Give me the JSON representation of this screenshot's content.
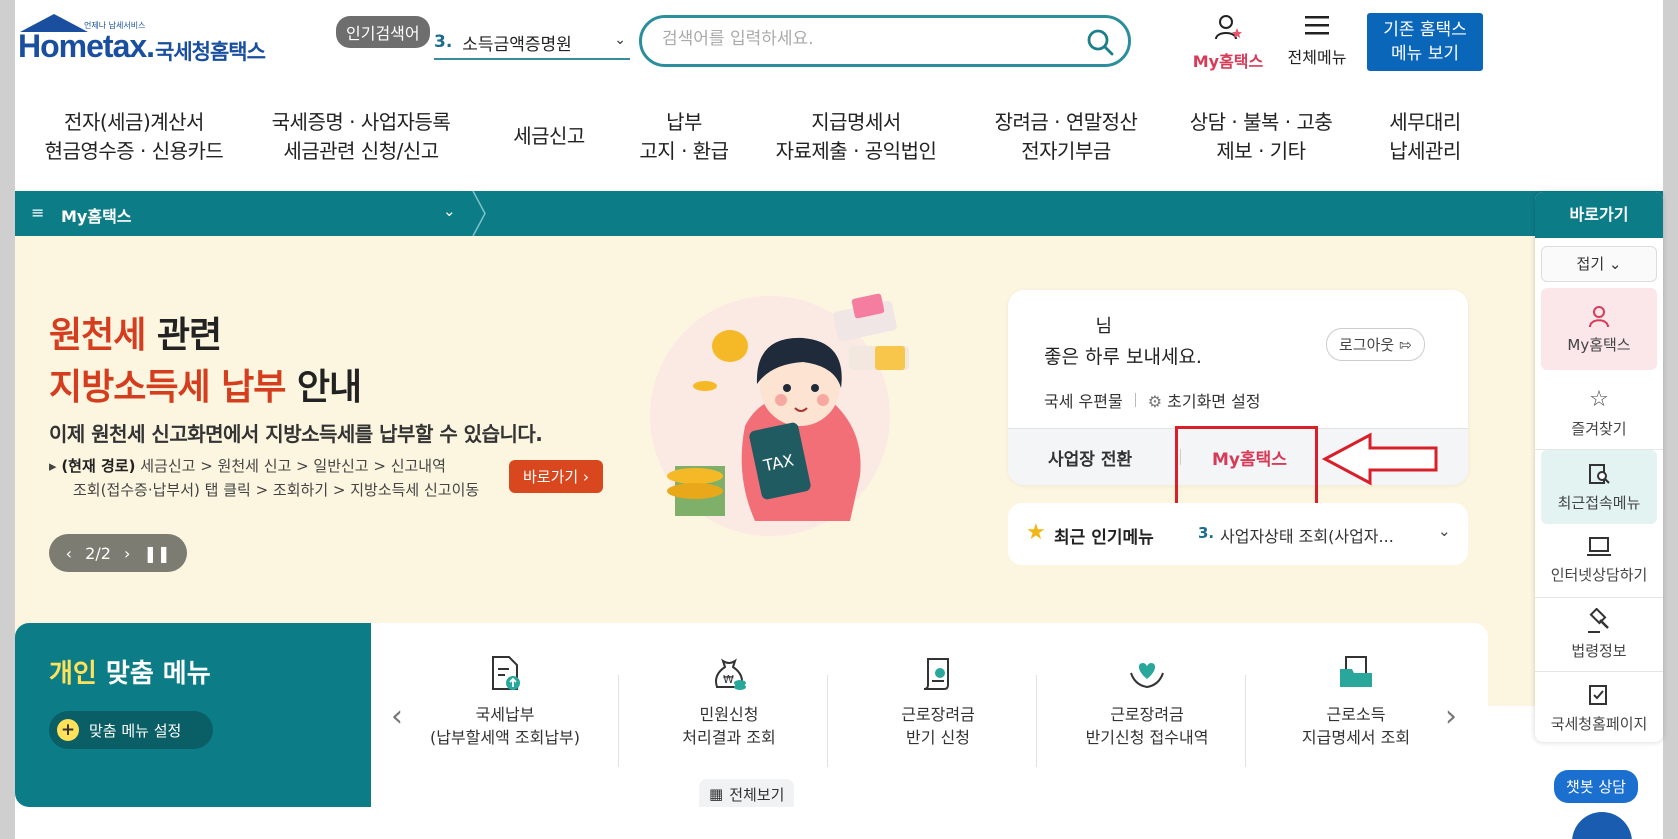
{
  "header": {
    "logo_brand": "Hometax.",
    "logo_small": "언제나 납세서비스",
    "logo_kr": "국세청홈택스",
    "popular_badge": "인기검색어",
    "popular_num": "3.",
    "popular_term": "소득금액증명원",
    "search_placeholder": "검색어를 입력하세요.",
    "my_label": "My홈택스",
    "all_menu_label": "전체메뉴",
    "old_menu_line1": "기존 홈택스",
    "old_menu_line2": "메뉴 보기"
  },
  "gnb": [
    {
      "line1": "전자(세금)계산서",
      "line2": "현금영수증 · 신용카드"
    },
    {
      "line1": "국세증명 · 사업자등록",
      "line2": "세금관련 신청/신고"
    },
    {
      "line1": "세금신고",
      "line2": ""
    },
    {
      "line1": "납부",
      "line2": "고지 · 환급"
    },
    {
      "line1": "지급명세서",
      "line2": "자료제출 · 공익법인"
    },
    {
      "line1": "장려금 · 연말정산",
      "line2": "전자기부금"
    },
    {
      "line1": "상담 · 불복 · 고충",
      "line2": "제보 · 기타"
    },
    {
      "line1": "세무대리",
      "line2": "납세관리"
    }
  ],
  "tealbar": {
    "title": "My홈택스"
  },
  "hero": {
    "title_red1": "원천세",
    "title_black1": " 관련",
    "title_red2": "지방소득세 납부",
    "title_black2": " 안내",
    "desc": "이제 원천세 신고화면에서 지방소득세를 납부할 수 있습니다.",
    "path_bold": "(현재 경로)",
    "path_line1": " 세금신고 > 원천세 신고 > 일반신고 > 신고내역",
    "path_line2": "조회(접수증·납부서) 탭 클릭 > 조회하기 > 지방소득세 신고이동",
    "go_button": "바로가기",
    "pager": "2/2"
  },
  "card": {
    "name_suffix": "님",
    "greeting": "좋은 하루 보내세요.",
    "logout": "로그아웃",
    "link_mail": "국세 우편물",
    "link_settings": "초기화면 설정",
    "switch_biz": "사업장 전환",
    "my_hometax": "My홈택스"
  },
  "popular": {
    "label": "최근 인기메뉴",
    "num": "3.",
    "text": "사업자상태 조회(사업자..."
  },
  "personal_menu": {
    "title_yellow": "개인",
    "title_white": " 맞춤 메뉴",
    "set_button": "맞춤 메뉴 설정",
    "items": [
      {
        "line1": "국세납부",
        "line2": "(납부할세액 조회납부)"
      },
      {
        "line1": "민원신청",
        "line2": "처리결과 조회"
      },
      {
        "line1": "근로장려금",
        "line2": "반기 신청"
      },
      {
        "line1": "근로장려금",
        "line2": "반기신청 접수내역"
      },
      {
        "line1": "근로소득",
        "line2": "지급명세서 조회"
      }
    ],
    "all_view": "전체보기"
  },
  "quick": {
    "head": "바로가기",
    "fold": "접기",
    "items": [
      "My홈택스",
      "즐겨찾기",
      "최근접속메뉴",
      "인터넷상담하기",
      "법령정보",
      "국세청홈페이지"
    ]
  },
  "chatbot": "챗봇 상담",
  "colors": {
    "teal": "#0c7d87",
    "accent_red": "#d63c58",
    "brand_blue": "#1a4fa0",
    "highlight_box": "#d8202a"
  }
}
